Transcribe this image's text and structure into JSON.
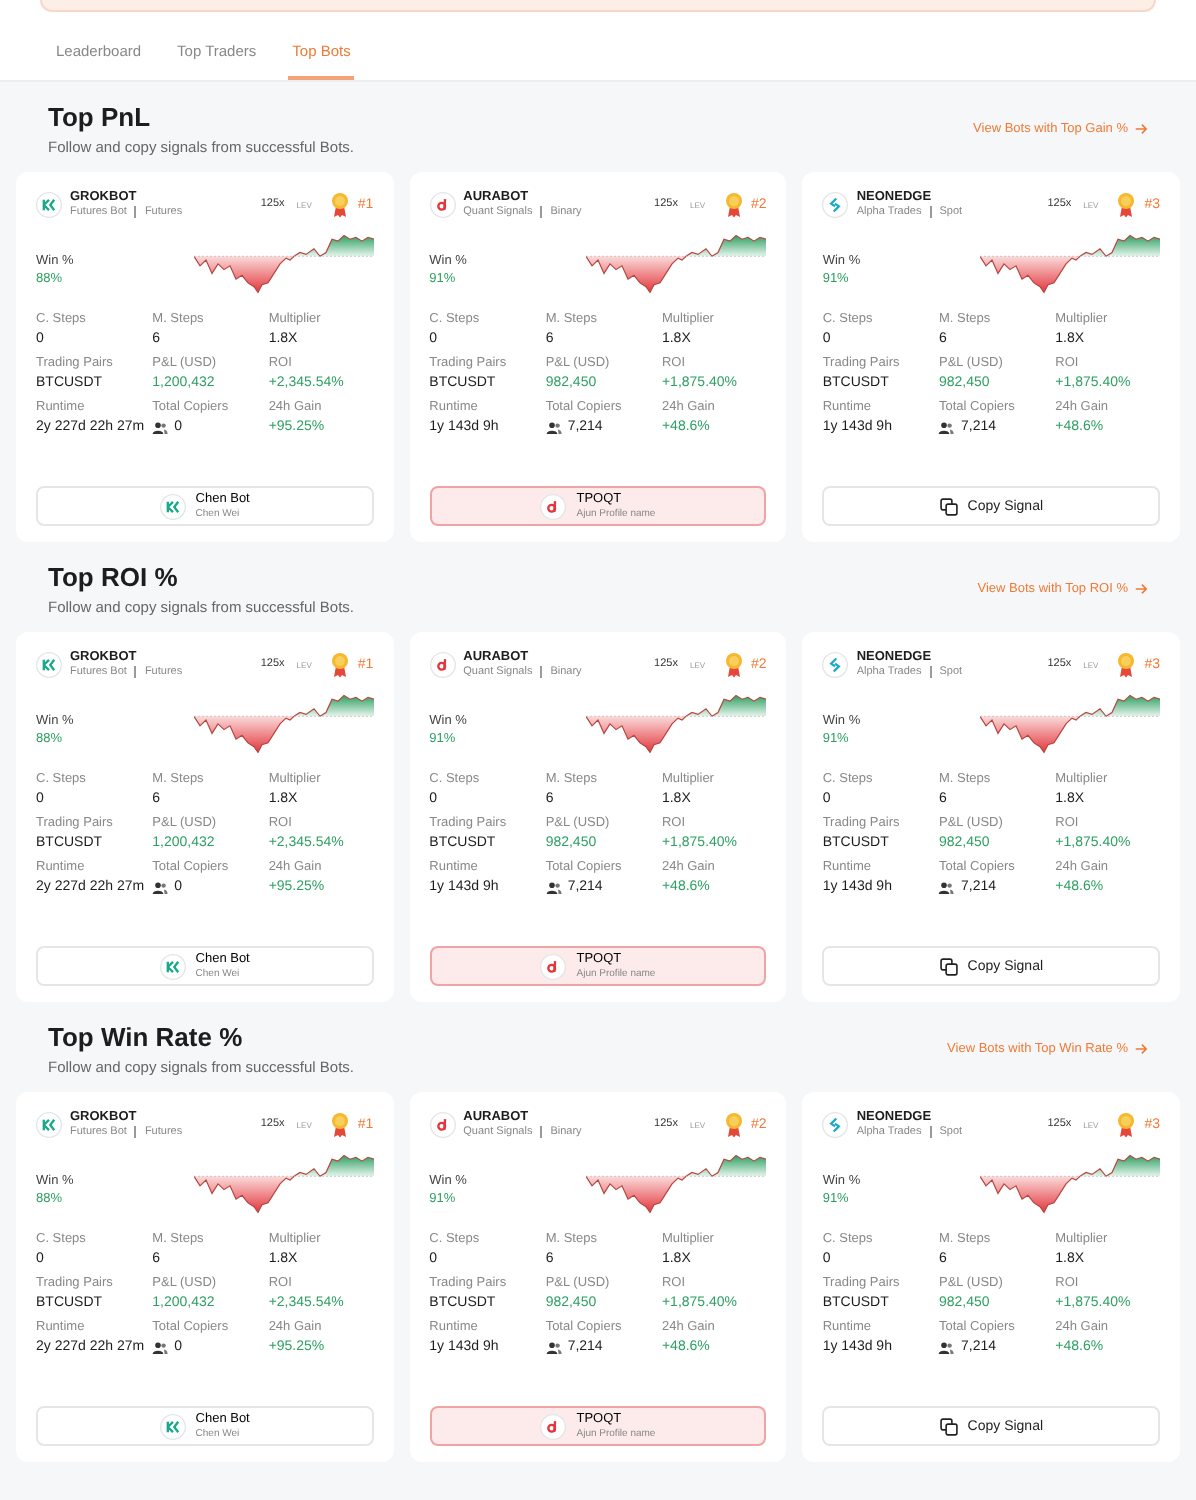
{
  "tabs": [
    {
      "label": "Leaderboard",
      "selected": false
    },
    {
      "label": "Top Traders",
      "selected": false
    },
    {
      "label": "Top Bots",
      "selected": true
    }
  ],
  "sections": [
    {
      "title": "Top PnL",
      "subtitle": "Follow and copy signals from successful Bots.",
      "link": "View Bots with Top Gain %",
      "cards": [
        {
          "kind": "grok",
          "name": "GROKBOT",
          "type": "Futures Bot",
          "market": "Futures",
          "leverage": "125x",
          "lev_unit": "LEV",
          "rank": "#1",
          "win_label": "Win %",
          "win": "88%",
          "stats": [
            {
              "kind": "text",
              "label": "C. Steps",
              "value": "0",
              "positive": false
            },
            {
              "kind": "text",
              "label": "M. Steps",
              "value": "6",
              "positive": false
            },
            {
              "kind": "text",
              "label": "Multiplier",
              "value": "1.8X",
              "positive": false
            },
            {
              "kind": "text",
              "label": "Trading Pairs",
              "value": "BTCUSDT",
              "positive": false
            },
            {
              "kind": "text",
              "label": "P&L (USD)",
              "value": "1,200,432",
              "positive": true
            },
            {
              "kind": "text",
              "label": "ROI",
              "value": "+2,345.54%",
              "positive": true
            },
            {
              "kind": "text",
              "label": "Runtime",
              "value": "2y 227d 22h 27m",
              "positive": false
            },
            {
              "kind": "copiers",
              "label": "Total Copiers",
              "value": "0"
            },
            {
              "kind": "text",
              "label": "24h Gain",
              "value": "+95.25%",
              "positive": true
            }
          ],
          "footer": {
            "kind": "profile",
            "highlighted": false,
            "name": "Chen Bot",
            "sub": "Chen Wei"
          }
        },
        {
          "kind": "aura",
          "name": "AURABOT",
          "type": "Quant Signals",
          "market": "Binary",
          "leverage": "125x",
          "lev_unit": "LEV",
          "rank": "#2",
          "win_label": "Win %",
          "win": "91%",
          "stats": [
            {
              "kind": "text",
              "label": "C. Steps",
              "value": "0",
              "positive": false
            },
            {
              "kind": "text",
              "label": "M. Steps",
              "value": "6",
              "positive": false
            },
            {
              "kind": "text",
              "label": "Multiplier",
              "value": "1.8X",
              "positive": false
            },
            {
              "kind": "text",
              "label": "Trading Pairs",
              "value": "BTCUSDT",
              "positive": false
            },
            {
              "kind": "text",
              "label": "P&L (USD)",
              "value": "982,450",
              "positive": true
            },
            {
              "kind": "text",
              "label": "ROI",
              "value": "+1,875.40%",
              "positive": true
            },
            {
              "kind": "text",
              "label": "Runtime",
              "value": "1y 143d 9h",
              "positive": false
            },
            {
              "kind": "copiers",
              "label": "Total Copiers",
              "value": "7,214"
            },
            {
              "kind": "text",
              "label": "24h Gain",
              "value": "+48.6%",
              "positive": true
            }
          ],
          "footer": {
            "kind": "profile",
            "highlighted": true,
            "name": "TPOQT",
            "sub": "Ajun Profile name"
          }
        },
        {
          "kind": "neon",
          "name": "NEONEDGE",
          "type": "Alpha Trades",
          "market": "Spot",
          "leverage": "125x",
          "lev_unit": "LEV",
          "rank": "#3",
          "win_label": "Win %",
          "win": "91%",
          "stats": [
            {
              "kind": "text",
              "label": "C. Steps",
              "value": "0",
              "positive": false
            },
            {
              "kind": "text",
              "label": "M. Steps",
              "value": "6",
              "positive": false
            },
            {
              "kind": "text",
              "label": "Multiplier",
              "value": "1.8X",
              "positive": false
            },
            {
              "kind": "text",
              "label": "Trading Pairs",
              "value": "BTCUSDT",
              "positive": false
            },
            {
              "kind": "text",
              "label": "P&L (USD)",
              "value": "982,450",
              "positive": true
            },
            {
              "kind": "text",
              "label": "ROI",
              "value": "+1,875.40%",
              "positive": true
            },
            {
              "kind": "text",
              "label": "Runtime",
              "value": "1y 143d 9h",
              "positive": false
            },
            {
              "kind": "copiers",
              "label": "Total Copiers",
              "value": "7,214"
            },
            {
              "kind": "text",
              "label": "24h Gain",
              "value": "+48.6%",
              "positive": true
            }
          ],
          "footer": {
            "kind": "copy",
            "label": "Copy Signal"
          }
        }
      ]
    },
    {
      "title": "Top ROI %",
      "subtitle": "Follow and copy signals from successful Bots.",
      "link": "View Bots with Top ROI %",
      "cards": [
        {
          "kind": "grok",
          "name": "GROKBOT",
          "type": "Futures Bot",
          "market": "Futures",
          "leverage": "125x",
          "lev_unit": "LEV",
          "rank": "#1",
          "win_label": "Win %",
          "win": "88%",
          "stats": [
            {
              "kind": "text",
              "label": "C. Steps",
              "value": "0",
              "positive": false
            },
            {
              "kind": "text",
              "label": "M. Steps",
              "value": "6",
              "positive": false
            },
            {
              "kind": "text",
              "label": "Multiplier",
              "value": "1.8X",
              "positive": false
            },
            {
              "kind": "text",
              "label": "Trading Pairs",
              "value": "BTCUSDT",
              "positive": false
            },
            {
              "kind": "text",
              "label": "P&L (USD)",
              "value": "1,200,432",
              "positive": true
            },
            {
              "kind": "text",
              "label": "ROI",
              "value": "+2,345.54%",
              "positive": true
            },
            {
              "kind": "text",
              "label": "Runtime",
              "value": "2y 227d 22h 27m",
              "positive": false
            },
            {
              "kind": "copiers",
              "label": "Total Copiers",
              "value": "0"
            },
            {
              "kind": "text",
              "label": "24h Gain",
              "value": "+95.25%",
              "positive": true
            }
          ],
          "footer": {
            "kind": "profile",
            "highlighted": false,
            "name": "Chen Bot",
            "sub": "Chen Wei"
          }
        },
        {
          "kind": "aura",
          "name": "AURABOT",
          "type": "Quant Signals",
          "market": "Binary",
          "leverage": "125x",
          "lev_unit": "LEV",
          "rank": "#2",
          "win_label": "Win %",
          "win": "91%",
          "stats": [
            {
              "kind": "text",
              "label": "C. Steps",
              "value": "0",
              "positive": false
            },
            {
              "kind": "text",
              "label": "M. Steps",
              "value": "6",
              "positive": false
            },
            {
              "kind": "text",
              "label": "Multiplier",
              "value": "1.8X",
              "positive": false
            },
            {
              "kind": "text",
              "label": "Trading Pairs",
              "value": "BTCUSDT",
              "positive": false
            },
            {
              "kind": "text",
              "label": "P&L (USD)",
              "value": "982,450",
              "positive": true
            },
            {
              "kind": "text",
              "label": "ROI",
              "value": "+1,875.40%",
              "positive": true
            },
            {
              "kind": "text",
              "label": "Runtime",
              "value": "1y 143d 9h",
              "positive": false
            },
            {
              "kind": "copiers",
              "label": "Total Copiers",
              "value": "7,214"
            },
            {
              "kind": "text",
              "label": "24h Gain",
              "value": "+48.6%",
              "positive": true
            }
          ],
          "footer": {
            "kind": "profile",
            "highlighted": true,
            "name": "TPOQT",
            "sub": "Ajun Profile name"
          }
        },
        {
          "kind": "neon",
          "name": "NEONEDGE",
          "type": "Alpha Trades",
          "market": "Spot",
          "leverage": "125x",
          "lev_unit": "LEV",
          "rank": "#3",
          "win_label": "Win %",
          "win": "91%",
          "stats": [
            {
              "kind": "text",
              "label": "C. Steps",
              "value": "0",
              "positive": false
            },
            {
              "kind": "text",
              "label": "M. Steps",
              "value": "6",
              "positive": false
            },
            {
              "kind": "text",
              "label": "Multiplier",
              "value": "1.8X",
              "positive": false
            },
            {
              "kind": "text",
              "label": "Trading Pairs",
              "value": "BTCUSDT",
              "positive": false
            },
            {
              "kind": "text",
              "label": "P&L (USD)",
              "value": "982,450",
              "positive": true
            },
            {
              "kind": "text",
              "label": "ROI",
              "value": "+1,875.40%",
              "positive": true
            },
            {
              "kind": "text",
              "label": "Runtime",
              "value": "1y 143d 9h",
              "positive": false
            },
            {
              "kind": "copiers",
              "label": "Total Copiers",
              "value": "7,214"
            },
            {
              "kind": "text",
              "label": "24h Gain",
              "value": "+48.6%",
              "positive": true
            }
          ],
          "footer": {
            "kind": "copy",
            "label": "Copy Signal"
          }
        }
      ]
    },
    {
      "title": "Top Win Rate %",
      "subtitle": "Follow and copy signals from successful Bots.",
      "link": "View Bots with Top Win Rate %",
      "cards": [
        {
          "kind": "grok",
          "name": "GROKBOT",
          "type": "Futures Bot",
          "market": "Futures",
          "leverage": "125x",
          "lev_unit": "LEV",
          "rank": "#1",
          "win_label": "Win %",
          "win": "88%",
          "stats": [
            {
              "kind": "text",
              "label": "C. Steps",
              "value": "0",
              "positive": false
            },
            {
              "kind": "text",
              "label": "M. Steps",
              "value": "6",
              "positive": false
            },
            {
              "kind": "text",
              "label": "Multiplier",
              "value": "1.8X",
              "positive": false
            },
            {
              "kind": "text",
              "label": "Trading Pairs",
              "value": "BTCUSDT",
              "positive": false
            },
            {
              "kind": "text",
              "label": "P&L (USD)",
              "value": "1,200,432",
              "positive": true
            },
            {
              "kind": "text",
              "label": "ROI",
              "value": "+2,345.54%",
              "positive": true
            },
            {
              "kind": "text",
              "label": "Runtime",
              "value": "2y 227d 22h 27m",
              "positive": false
            },
            {
              "kind": "copiers",
              "label": "Total Copiers",
              "value": "0"
            },
            {
              "kind": "text",
              "label": "24h Gain",
              "value": "+95.25%",
              "positive": true
            }
          ],
          "footer": {
            "kind": "profile",
            "highlighted": false,
            "name": "Chen Bot",
            "sub": "Chen Wei"
          }
        },
        {
          "kind": "aura",
          "name": "AURABOT",
          "type": "Quant Signals",
          "market": "Binary",
          "leverage": "125x",
          "lev_unit": "LEV",
          "rank": "#2",
          "win_label": "Win %",
          "win": "91%",
          "stats": [
            {
              "kind": "text",
              "label": "C. Steps",
              "value": "0",
              "positive": false
            },
            {
              "kind": "text",
              "label": "M. Steps",
              "value": "6",
              "positive": false
            },
            {
              "kind": "text",
              "label": "Multiplier",
              "value": "1.8X",
              "positive": false
            },
            {
              "kind": "text",
              "label": "Trading Pairs",
              "value": "BTCUSDT",
              "positive": false
            },
            {
              "kind": "text",
              "label": "P&L (USD)",
              "value": "982,450",
              "positive": true
            },
            {
              "kind": "text",
              "label": "ROI",
              "value": "+1,875.40%",
              "positive": true
            },
            {
              "kind": "text",
              "label": "Runtime",
              "value": "1y 143d 9h",
              "positive": false
            },
            {
              "kind": "copiers",
              "label": "Total Copiers",
              "value": "7,214"
            },
            {
              "kind": "text",
              "label": "24h Gain",
              "value": "+48.6%",
              "positive": true
            }
          ],
          "footer": {
            "kind": "profile",
            "highlighted": true,
            "name": "TPOQT",
            "sub": "Ajun Profile name"
          }
        },
        {
          "kind": "neon",
          "name": "NEONEDGE",
          "type": "Alpha Trades",
          "market": "Spot",
          "leverage": "125x",
          "lev_unit": "LEV",
          "rank": "#3",
          "win_label": "Win %",
          "win": "91%",
          "stats": [
            {
              "kind": "text",
              "label": "C. Steps",
              "value": "0",
              "positive": false
            },
            {
              "kind": "text",
              "label": "M. Steps",
              "value": "6",
              "positive": false
            },
            {
              "kind": "text",
              "label": "Multiplier",
              "value": "1.8X",
              "positive": false
            },
            {
              "kind": "text",
              "label": "Trading Pairs",
              "value": "BTCUSDT",
              "positive": false
            },
            {
              "kind": "text",
              "label": "P&L (USD)",
              "value": "982,450",
              "positive": true
            },
            {
              "kind": "text",
              "label": "ROI",
              "value": "+1,875.40%",
              "positive": true
            },
            {
              "kind": "text",
              "label": "Runtime",
              "value": "1y 143d 9h",
              "positive": false
            },
            {
              "kind": "copiers",
              "label": "Total Copiers",
              "value": "7,214"
            },
            {
              "kind": "text",
              "label": "24h Gain",
              "value": "+48.6%",
              "positive": true
            }
          ],
          "footer": {
            "kind": "copy",
            "label": "Copy Signal"
          }
        }
      ]
    }
  ]
}
